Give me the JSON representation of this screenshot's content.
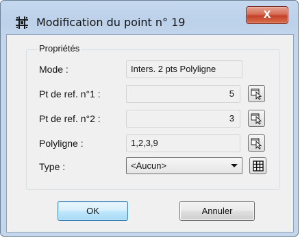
{
  "window": {
    "title": "Modification du point n° 19",
    "icon": "point-grid-icon",
    "close_label": "X"
  },
  "properties": {
    "group_title": "Propriétés",
    "mode": {
      "label": "Mode :",
      "value": "Inters. 2 pts Polyligne"
    },
    "ref_point_1": {
      "label": "Pt de ref. n°1 :",
      "value": "5",
      "button_icon": "pick-point-icon"
    },
    "ref_point_2": {
      "label": "Pt de ref. n°2 :",
      "value": "3",
      "button_icon": "pick-point-icon"
    },
    "polyline": {
      "label": "Polyligne :",
      "value": "1,2,3,9",
      "button_icon": "pick-point-icon"
    },
    "type": {
      "label": "Type :",
      "selected": "<Aucun>",
      "button_icon": "grid-icon"
    }
  },
  "buttons": {
    "ok": "OK",
    "cancel": "Annuler"
  },
  "colors": {
    "titlebar": "#c5d8ee",
    "close_button": "#c5412a",
    "ok_button_border": "#3c7fb1"
  }
}
